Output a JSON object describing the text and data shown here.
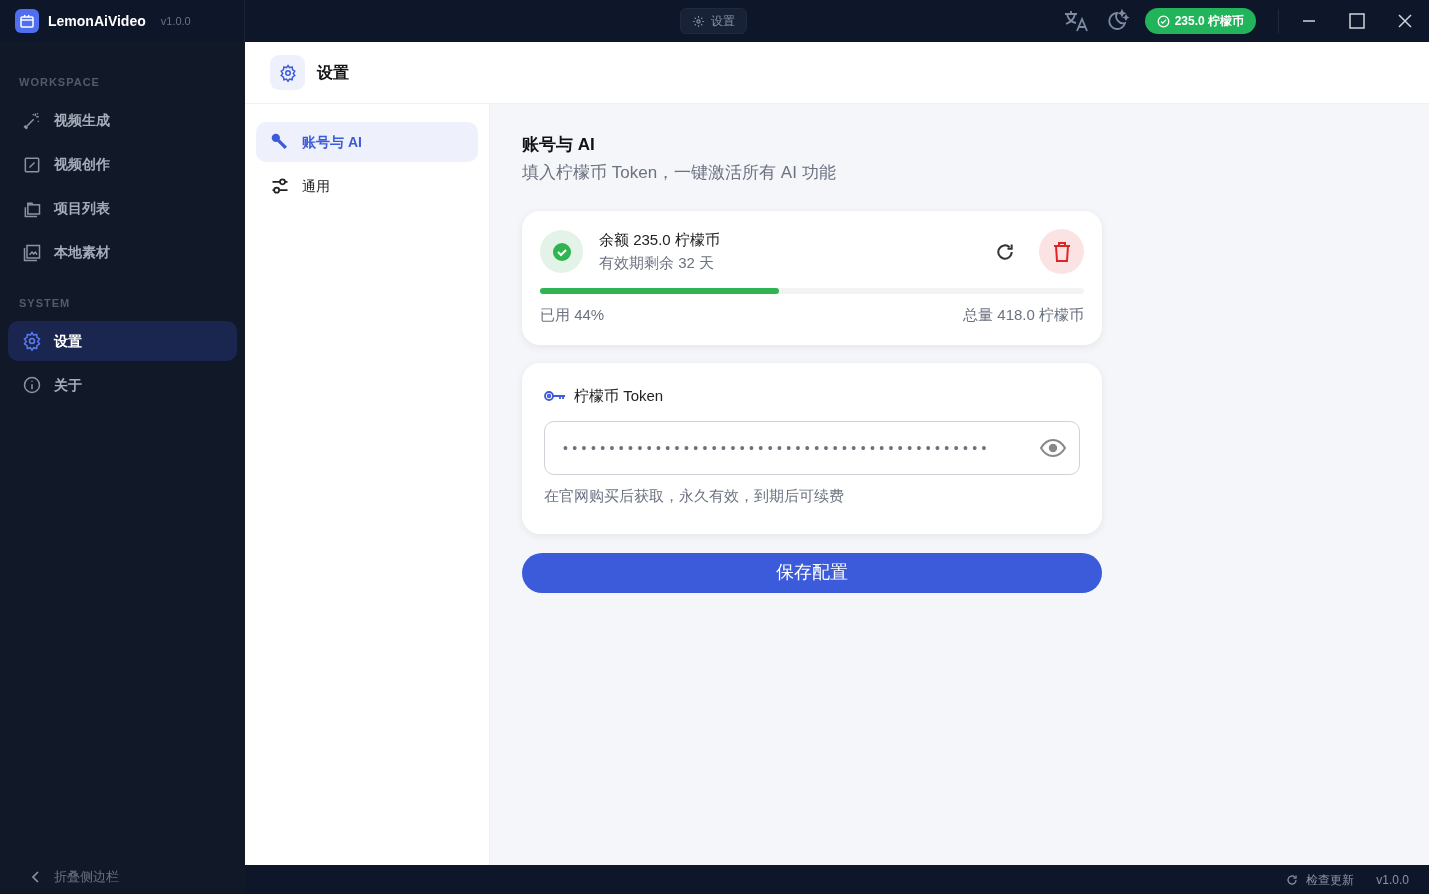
{
  "titlebar": {
    "app_name": "LemonAiVideo",
    "version": "v1.0.0",
    "page_tab": "设置",
    "balance_badge": "235.0 柠檬币"
  },
  "sidebar": {
    "sections": [
      {
        "heading": "WORKSPACE",
        "items": [
          {
            "label": "视频生成",
            "selected": false
          },
          {
            "label": "视频创作",
            "selected": false
          },
          {
            "label": "项目列表",
            "selected": false
          },
          {
            "label": "本地素材",
            "selected": false
          }
        ]
      },
      {
        "heading": "SYSTEM",
        "items": [
          {
            "label": "设置",
            "selected": true
          },
          {
            "label": "关于",
            "selected": false
          }
        ]
      }
    ],
    "collapse": "折叠侧边栏"
  },
  "page_header": {
    "title": "设置"
  },
  "settings_nav": [
    {
      "label": "账号与 AI",
      "selected": true
    },
    {
      "label": "通用",
      "selected": false
    }
  ],
  "section": {
    "title": "账号与 AI",
    "subtitle": "填入柠檬币 Token，一键激活所有 AI 功能"
  },
  "balance_card": {
    "balance": "余额 235.0 柠檬币",
    "expiry": "有效期剩余 32 天",
    "level": 0.44,
    "used": "已用 44%",
    "total": "总量 418.0 柠檬币"
  },
  "token_card": {
    "label": "柠檬币 Token",
    "value": "••••••••••••••••••••••••••••••••••••••••••••••",
    "hint": "在官网购买后获取，永久有效，到期后可续费"
  },
  "save_button": "保存配置",
  "status_bar": {
    "check_update": "检查更新",
    "version": "v1.0.0"
  }
}
